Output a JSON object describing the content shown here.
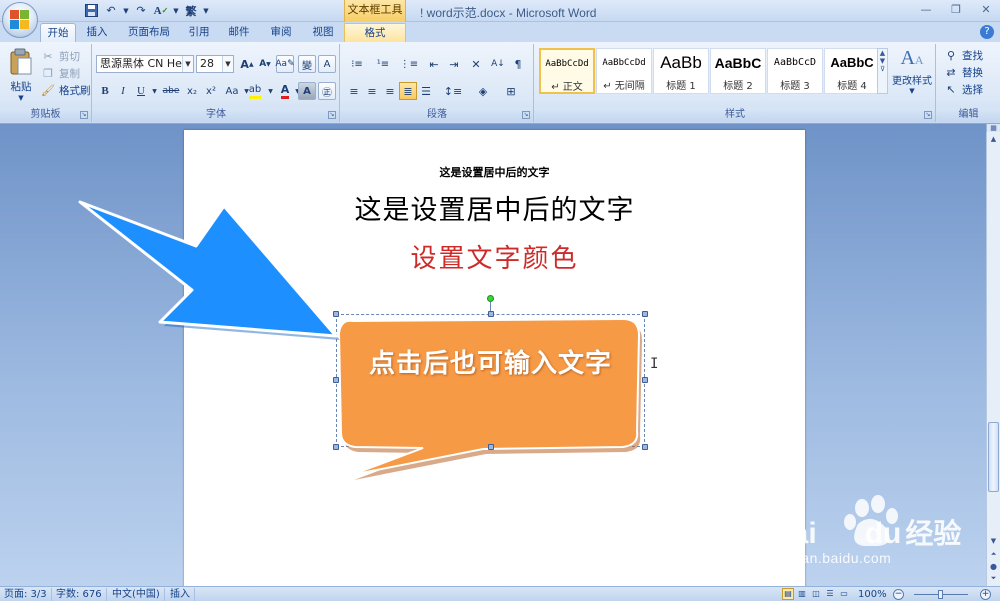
{
  "window": {
    "title": "! word示范.docx - Microsoft Word",
    "context_tab_group": "文本框工具"
  },
  "qat": {
    "save_icon": "save-icon",
    "undo_icon": "undo-icon",
    "redo_icon": "redo-icon",
    "spell_icon": "spelling-icon",
    "trad_icon": "繁"
  },
  "tabs": [
    {
      "label": "开始",
      "active": true
    },
    {
      "label": "插入"
    },
    {
      "label": "页面布局"
    },
    {
      "label": "引用"
    },
    {
      "label": "邮件"
    },
    {
      "label": "审阅"
    },
    {
      "label": "视图"
    },
    {
      "label": "格式",
      "contextual": true
    }
  ],
  "clipboard": {
    "group_label": "剪贴板",
    "paste": "粘贴",
    "cut": "剪切",
    "copy": "复制",
    "format_painter": "格式刷"
  },
  "font": {
    "group_label": "字体",
    "font_name": "思源黑体 CN Heavy",
    "font_size": "28",
    "bold": "B",
    "italic": "I",
    "underline": "U",
    "strike": "abe",
    "sub": "x₂",
    "sup": "x²",
    "case": "Aa",
    "grow": "A",
    "shrink": "A",
    "font_color": "A",
    "highlight": "ab"
  },
  "paragraph": {
    "group_label": "段落"
  },
  "styles": {
    "group_label": "样式",
    "change_styles": "更改样式",
    "items": [
      {
        "sample": "AaBbCcDd",
        "name": "↵ 正文",
        "selected": true
      },
      {
        "sample": "AaBbCcDd",
        "name": "↵ 无间隔"
      },
      {
        "sample": "AaBb",
        "name": "标题 1"
      },
      {
        "sample": "AaBbC",
        "name": "标题 2"
      },
      {
        "sample": "AaBbCcD",
        "name": "标题 3"
      },
      {
        "sample": "AaBbC",
        "name": "标题 4"
      }
    ]
  },
  "editing": {
    "group_label": "编辑",
    "find": "查找",
    "replace": "替换",
    "select": "选择"
  },
  "document": {
    "line1": "这是设置居中后的文字",
    "line2": "这是设置居中后的文字",
    "line3": "设置文字颜色",
    "callout_text": "点击后也可输入文字",
    "colors": {
      "red_text": "#cf2a2a",
      "callout_fill": "#f79a46",
      "arrow_fill": "#1e8fff"
    }
  },
  "status": {
    "page": "页面: 3/3",
    "words": "字数: 676",
    "language": "中文(中国)",
    "mode": "插入",
    "zoom": "100%",
    "zoom_fraction": 0.5
  },
  "watermark": {
    "brand": "Bai",
    "brand2": "du",
    "cn": "经验",
    "url": "jingyan.baidu.com"
  }
}
